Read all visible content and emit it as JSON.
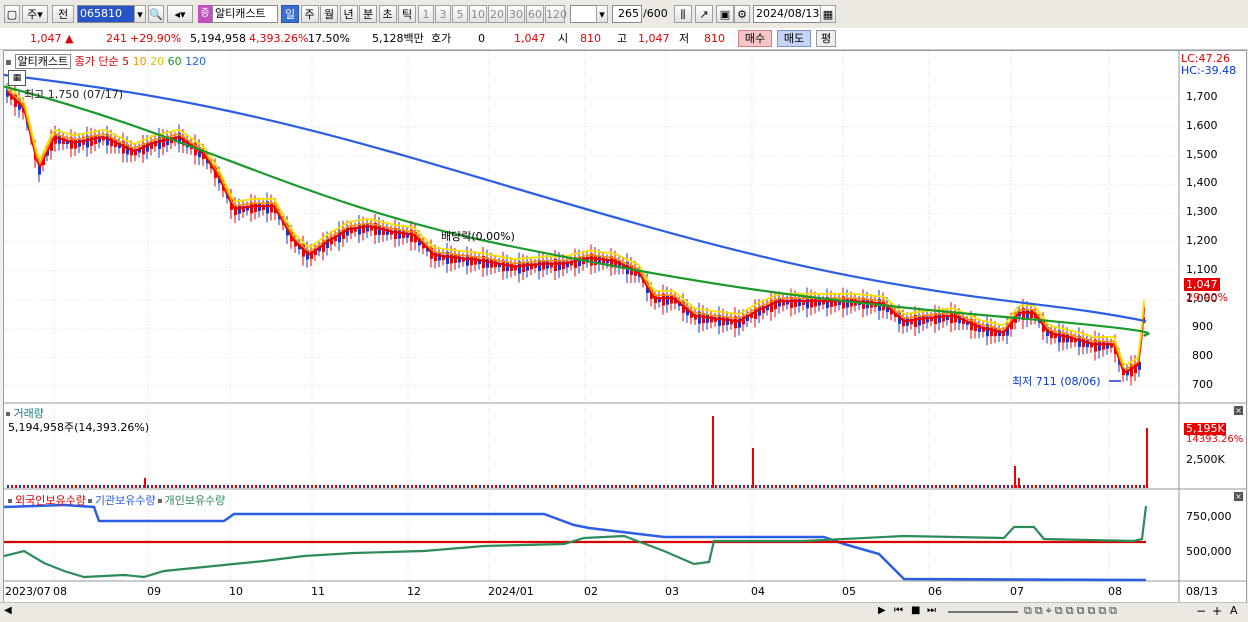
{
  "toolbar": {
    "market_label": "주",
    "prev_label": "전",
    "code_value": "065810",
    "stock_type_badge": "증",
    "stock_name": "알티캐스트",
    "periods": [
      "일",
      "주",
      "월",
      "년",
      "분",
      "초",
      "틱"
    ],
    "active_period": "일",
    "intervals": [
      "1",
      "3",
      "5",
      "10",
      "20",
      "30",
      "60",
      "120"
    ],
    "count_value": "265",
    "count_total": "/600",
    "date_value": "2024/08/13"
  },
  "quote": {
    "price": "1,047",
    "change": "241",
    "change_pct": "+29.90%",
    "volume": "5,194,958",
    "volume_pct": "4,393.26%",
    "turnover": "17.50%",
    "amount": "5,128백만",
    "hoga_label": "호가",
    "hoga_value": "0",
    "hoga_price": "1,047",
    "open_label": "시",
    "open": "810",
    "high_label": "고",
    "high": "1,047",
    "low_label": "저",
    "low": "810",
    "buy_label": "매수",
    "sell_label": "매도",
    "eval_label": "평"
  },
  "price_panel": {
    "title": "알티캐스트",
    "ma_label": "종가 단순",
    "ma_periods": [
      {
        "label": "5",
        "color": "#e60000"
      },
      {
        "label": "10",
        "color": "#ff8c00"
      },
      {
        "label": "20",
        "color": "#f5e000"
      },
      {
        "label": "60",
        "color": "#1a9a2a"
      },
      {
        "label": "120",
        "color": "#2a5ee6"
      }
    ],
    "lc": "LC:47.26",
    "hc": "HC:-39.48",
    "y_ticks": [
      "1,700",
      "1,600",
      "1,500",
      "1,400",
      "1,300",
      "1,200",
      "1,100",
      "1,000",
      "900",
      "800",
      "700"
    ],
    "high_note": "최고 1,750 (07/17)",
    "low_note": "최저 711 (08/06)",
    "dividend_note": "배당락(0.00%)",
    "last_price_tag": "1,047",
    "last_pct_tag": "29.90%"
  },
  "volume_panel": {
    "title": "거래량",
    "summary": "5,194,958주(14,393.26%)",
    "tag_value": "5,195K",
    "tag_pct": "14393.26%",
    "y_tick": "2,500K"
  },
  "holder_panel": {
    "legend": [
      {
        "label": "외국인보유수량",
        "color": "#e60000"
      },
      {
        "label": "기관보유수량",
        "color": "#2a5ee6"
      },
      {
        "label": "개인보유수량",
        "color": "#2e8b57"
      }
    ],
    "y_ticks": [
      "750,000",
      "500,000"
    ]
  },
  "x_axis": [
    "2023/07",
    "08",
    "09",
    "10",
    "11",
    "12",
    "2024/01",
    "02",
    "03",
    "04",
    "05",
    "06",
    "07",
    "08",
    "08/13"
  ]
}
